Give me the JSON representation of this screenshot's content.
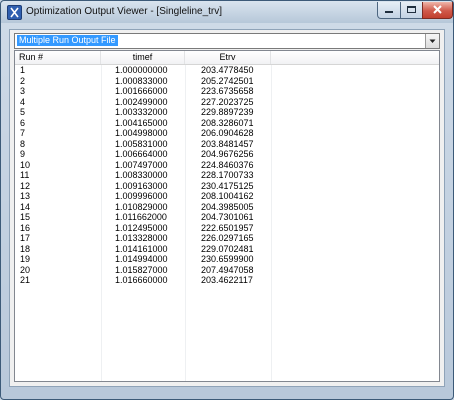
{
  "window": {
    "title": "Optimization Output Viewer - [Singleline_trv]"
  },
  "icons": {
    "app": "app-icon",
    "minimize": "minimize-icon",
    "maximize": "maximize-icon",
    "close": "close-icon",
    "dropdown": "chevron-down-icon"
  },
  "colors": {
    "selection": "#3399ff",
    "close_button": "#c94434"
  },
  "selector": {
    "value": "Multiple Run Output File"
  },
  "table": {
    "columns": [
      "Run #",
      "timef",
      "Etrv",
      ""
    ],
    "rows": [
      [
        "1",
        "1.000000000",
        "203.4778450"
      ],
      [
        "2",
        "1.000833000",
        "205.2742501"
      ],
      [
        "3",
        "1.001666000",
        "223.6735658"
      ],
      [
        "4",
        "1.002499000",
        "227.2023725"
      ],
      [
        "5",
        "1.003332000",
        "229.8897239"
      ],
      [
        "6",
        "1.004165000",
        "208.3286071"
      ],
      [
        "7",
        "1.004998000",
        "206.0904628"
      ],
      [
        "8",
        "1.005831000",
        "203.8481457"
      ],
      [
        "9",
        "1.006664000",
        "204.9676256"
      ],
      [
        "10",
        "1.007497000",
        "224.8460376"
      ],
      [
        "11",
        "1.008330000",
        "228.1700733"
      ],
      [
        "12",
        "1.009163000",
        "230.4175125"
      ],
      [
        "13",
        "1.009996000",
        "208.1004162"
      ],
      [
        "14",
        "1.010829000",
        "204.3985005"
      ],
      [
        "15",
        "1.011662000",
        "204.7301061"
      ],
      [
        "16",
        "1.012495000",
        "222.6501957"
      ],
      [
        "17",
        "1.013328000",
        "226.0297165"
      ],
      [
        "18",
        "1.014161000",
        "229.0702481"
      ],
      [
        "19",
        "1.014994000",
        "230.6599900"
      ],
      [
        "20",
        "1.015827000",
        "207.4947058"
      ],
      [
        "21",
        "1.016660000",
        "203.4622117"
      ]
    ]
  }
}
